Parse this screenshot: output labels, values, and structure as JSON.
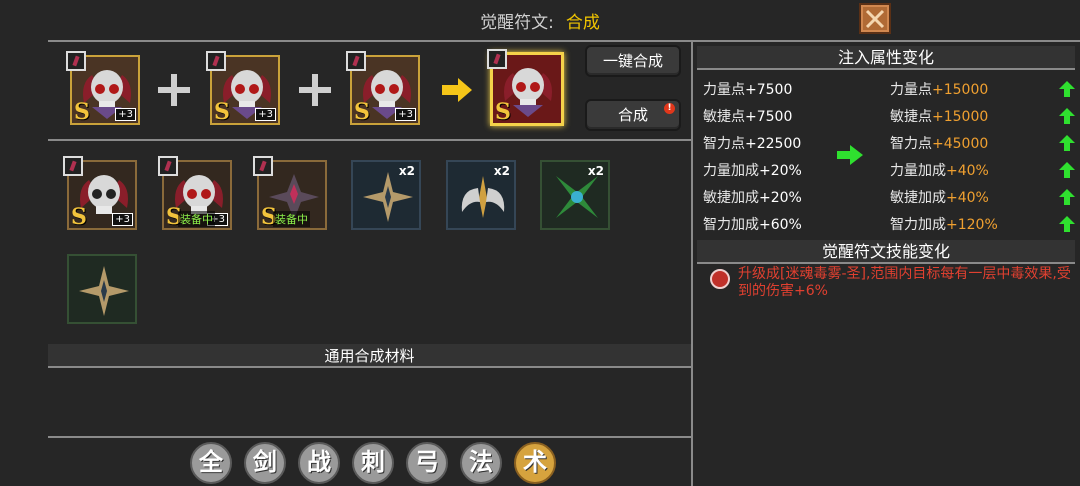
{
  "header": {
    "label": "觉醒符文:",
    "mode": "合成"
  },
  "icons": {
    "close": "close-x-icon"
  },
  "buttons": {
    "auto_combine": "一键合成",
    "combine": "合成",
    "combine_badge": "!"
  },
  "top_slots": {
    "level_badge": "+3",
    "rank": "S"
  },
  "inventory": {
    "items": [
      {
        "rank": "S",
        "badge": "+3",
        "equipped": ""
      },
      {
        "rank": "S",
        "badge": "+3",
        "equipped": "装备中"
      },
      {
        "rank": "S",
        "badge": "",
        "equipped": "装备中"
      },
      {
        "count": "x2"
      },
      {
        "count": "x2"
      },
      {
        "count": "x2"
      },
      {
        "count": ""
      }
    ]
  },
  "materials_title": "通用合成材料",
  "tabs": [
    "全",
    "剑",
    "战",
    "刺",
    "弓",
    "法",
    "术"
  ],
  "active_tab": "术",
  "attr_panel": {
    "title": "注入属性变化",
    "before": [
      {
        "name": "力量点",
        "value": "+7500"
      },
      {
        "name": "敏捷点",
        "value": "+7500"
      },
      {
        "name": "智力点",
        "value": "+22500"
      },
      {
        "name": "力量加成",
        "value": "+20%"
      },
      {
        "name": "敏捷加成",
        "value": "+20%"
      },
      {
        "name": "智力加成",
        "value": "+60%"
      }
    ],
    "after": [
      {
        "name": "力量点",
        "value": "+15000"
      },
      {
        "name": "敏捷点",
        "value": "+15000"
      },
      {
        "name": "智力点",
        "value": "+45000"
      },
      {
        "name": "力量加成",
        "value": "+40%"
      },
      {
        "name": "敏捷加成",
        "value": "+40%"
      },
      {
        "name": "智力加成",
        "value": "+120%"
      }
    ]
  },
  "skill_panel": {
    "title": "觉醒符文技能变化",
    "description": "升级成[迷魂毒雾-圣],范围内目标每有一层中毒效果,受到的伤害+6%"
  },
  "colors": {
    "accent_gold": "#f0c400",
    "value_orange": "#f0a030",
    "skill_red": "#e04030",
    "up_green": "#2fe02f"
  }
}
